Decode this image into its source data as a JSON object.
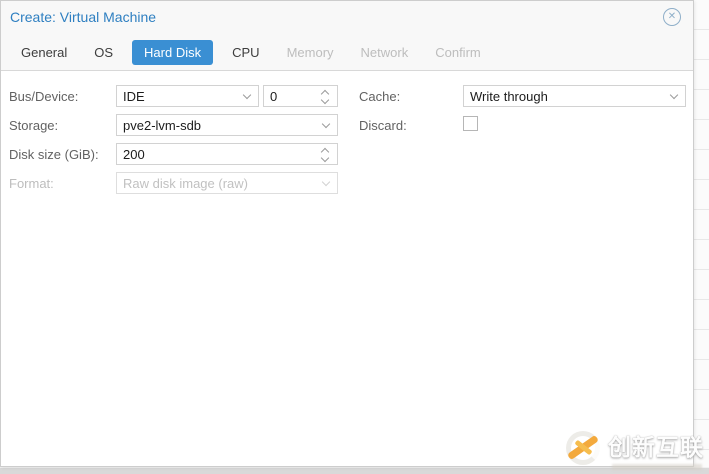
{
  "dialog": {
    "title": "Create: Virtual Machine",
    "close_glyph": "✕",
    "tabs": [
      {
        "label": "General",
        "state": "normal"
      },
      {
        "label": "OS",
        "state": "normal"
      },
      {
        "label": "Hard Disk",
        "state": "active"
      },
      {
        "label": "CPU",
        "state": "normal"
      },
      {
        "label": "Memory",
        "state": "disabled"
      },
      {
        "label": "Network",
        "state": "disabled"
      },
      {
        "label": "Confirm",
        "state": "disabled"
      }
    ],
    "form": {
      "bus_device": {
        "label": "Bus/Device:",
        "value": "IDE",
        "device_number": "0"
      },
      "storage": {
        "label": "Storage:",
        "value": "pve2-lvm-sdb"
      },
      "disk_size": {
        "label": "Disk size (GiB):",
        "value": "200"
      },
      "format": {
        "label": "Format:",
        "value": "Raw disk image (raw)",
        "disabled": true
      },
      "cache": {
        "label": "Cache:",
        "value": "Write through"
      },
      "discard": {
        "label": "Discard:",
        "checked": false
      }
    }
  },
  "watermark": {
    "text": "创新互联"
  },
  "colors": {
    "title_blue": "#2e7fc1",
    "active_tab_blue": "#3a8fd3",
    "disabled_text": "#bdbdbd",
    "watermark_orange": "#f3a93c",
    "dialog_border": "#cdcdcd"
  }
}
